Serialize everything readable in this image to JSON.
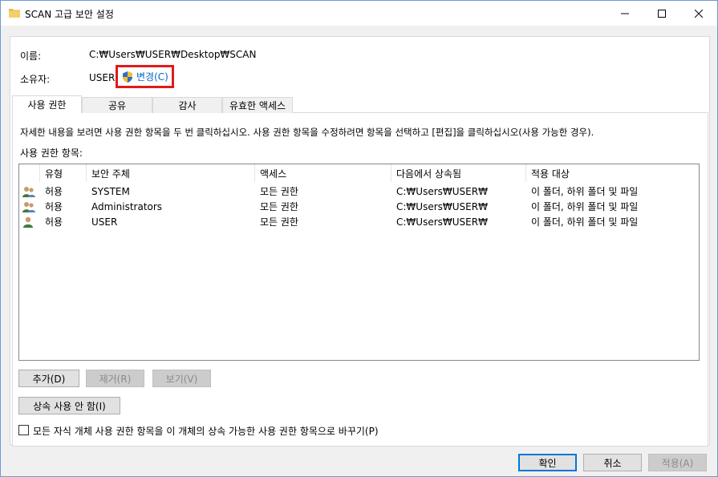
{
  "window": {
    "title": "SCAN 고급 보안 설정",
    "minimize_glyph": "—",
    "maximize_glyph": "☐",
    "close_glyph": "✕"
  },
  "info": {
    "name_label": "이름:",
    "name_value": "C:₩Users₩USER₩Desktop₩SCAN",
    "owner_label": "소유자:",
    "owner_value": "USER",
    "change_link": "변경(C)"
  },
  "tabs": [
    {
      "label": "사용 권한",
      "active": true
    },
    {
      "label": "공유",
      "active": false
    },
    {
      "label": "감사",
      "active": false
    },
    {
      "label": "유효한 액세스",
      "active": false
    }
  ],
  "permissions": {
    "description": "자세한 내용을 보려면 사용 권한 항목을 두 번 클릭하십시오. 사용 권한 항목을 수정하려면 항목을 선택하고 [편집]을 클릭하십시오(사용 가능한 경우).",
    "entries_label": "사용 권한 항목:",
    "columns": [
      "유형",
      "보안 주체",
      "액세스",
      "다음에서 상속됨",
      "적용 대상"
    ],
    "rows": [
      {
        "icon": "group-users-icon",
        "type": "허용",
        "principal": "SYSTEM",
        "access": "모든 권한",
        "inherited": "C:₩Users₩USER₩",
        "applies": "이 폴더, 하위 폴더 및 파일"
      },
      {
        "icon": "group-users-icon",
        "type": "허용",
        "principal": "Administrators",
        "access": "모든 권한",
        "inherited": "C:₩Users₩USER₩",
        "applies": "이 폴더, 하위 폴더 및 파일"
      },
      {
        "icon": "single-user-icon",
        "type": "허용",
        "principal": "USER",
        "access": "모든 권한",
        "inherited": "C:₩Users₩USER₩",
        "applies": "이 폴더, 하위 폴더 및 파일"
      }
    ]
  },
  "buttons": {
    "add": "추가(D)",
    "remove": "제거(R)",
    "view": "보기(V)",
    "disable_inheritance": "상속 사용 안 함(I)",
    "ok": "확인",
    "cancel": "취소",
    "apply": "적용(A)"
  },
  "replace_checkbox": {
    "label": "모든 자식 개체 사용 권한 항목을 이 개체의 상속 가능한 사용 권한 항목으로 바꾸기(P)",
    "checked": false
  },
  "colors": {
    "link": "#0066cc",
    "highlight_border": "#e01b1b",
    "default_button_border": "#0078d7"
  }
}
